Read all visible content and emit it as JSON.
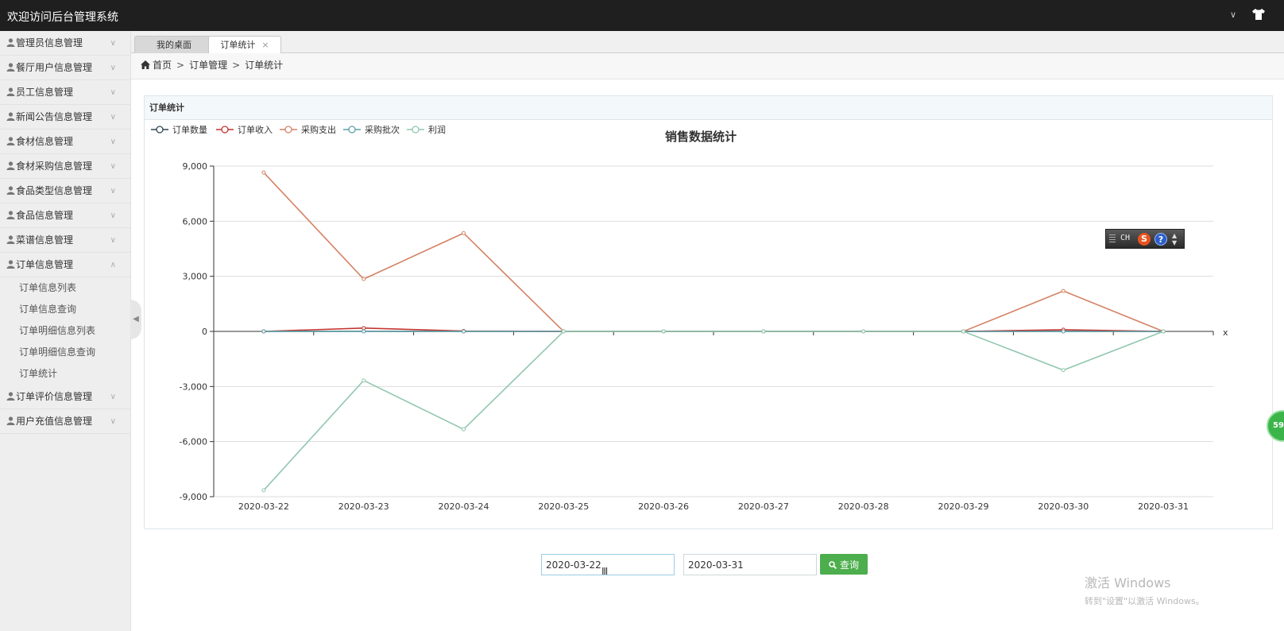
{
  "app": {
    "title": "欢迎访问后台管理系统"
  },
  "sidebar": {
    "items": [
      {
        "label": "管理员信息管理",
        "expanded": false
      },
      {
        "label": "餐厅用户信息管理",
        "expanded": false
      },
      {
        "label": "员工信息管理",
        "expanded": false
      },
      {
        "label": "新闻公告信息管理",
        "expanded": false
      },
      {
        "label": "食材信息管理",
        "expanded": false
      },
      {
        "label": "食材采购信息管理",
        "expanded": false
      },
      {
        "label": "食品类型信息管理",
        "expanded": false
      },
      {
        "label": "食品信息管理",
        "expanded": false
      },
      {
        "label": "菜谱信息管理",
        "expanded": false
      },
      {
        "label": "订单信息管理",
        "expanded": true
      },
      {
        "label": "订单评价信息管理",
        "expanded": false
      },
      {
        "label": "用户充值信息管理",
        "expanded": false
      }
    ],
    "submenu": [
      "订单信息列表",
      "订单信息查询",
      "订单明细信息列表",
      "订单明细信息查询",
      "订单统计"
    ]
  },
  "tabs": [
    {
      "label": "我的桌面",
      "active": false
    },
    {
      "label": "订单统计",
      "active": true,
      "close": "×"
    }
  ],
  "breadcrumb": {
    "home": "首页",
    "sep": ">",
    "level1": "订单管理",
    "level2": "订单统计"
  },
  "panel": {
    "title": "订单统计"
  },
  "chart_data": {
    "type": "line",
    "title": "销售数据统计",
    "xlabel": "x",
    "ylabel": "",
    "ylim": [
      -9000,
      9000
    ],
    "yticks": [
      9000,
      6000,
      3000,
      0,
      -3000,
      -6000,
      -9000
    ],
    "ytick_labels": [
      "9,000",
      "6,000",
      "3,000",
      "0",
      "-3,000",
      "-6,000",
      "-9,000"
    ],
    "grid": true,
    "legend_position": "top-left",
    "categories": [
      "2020-03-22",
      "2020-03-23",
      "2020-03-24",
      "2020-03-25",
      "2020-03-26",
      "2020-03-27",
      "2020-03-28",
      "2020-03-29",
      "2020-03-30",
      "2020-03-31"
    ],
    "series": [
      {
        "name": "订单数量",
        "color": "#2f4554",
        "values": [
          2,
          5,
          2,
          0,
          0,
          0,
          0,
          0,
          4,
          0
        ]
      },
      {
        "name": "订单收入",
        "color": "#c23531",
        "values": [
          0,
          180,
          20,
          0,
          0,
          0,
          0,
          0,
          90,
          0
        ]
      },
      {
        "name": "采购支出",
        "color": "#d48265",
        "values": [
          8650,
          2850,
          5350,
          0,
          0,
          0,
          0,
          0,
          2200,
          0
        ]
      },
      {
        "name": "采购批次",
        "color": "#61a0a8",
        "values": [
          1,
          1,
          1,
          0,
          0,
          0,
          0,
          0,
          1,
          0
        ]
      },
      {
        "name": "利润",
        "color": "#91c7ae",
        "values": [
          -8650,
          -2670,
          -5330,
          0,
          0,
          0,
          0,
          0,
          -2110,
          0
        ]
      }
    ]
  },
  "query": {
    "start_date": "2020-03-22",
    "end_date": "2020-03-31",
    "button_label": "查询"
  },
  "ime": {
    "label": "CH",
    "s": "S",
    "q": "?"
  },
  "watermark": {
    "line1": "激活 Windows",
    "line2": "转到\"设置\"以激活 Windows。"
  },
  "float_ball": {
    "text": "59"
  }
}
